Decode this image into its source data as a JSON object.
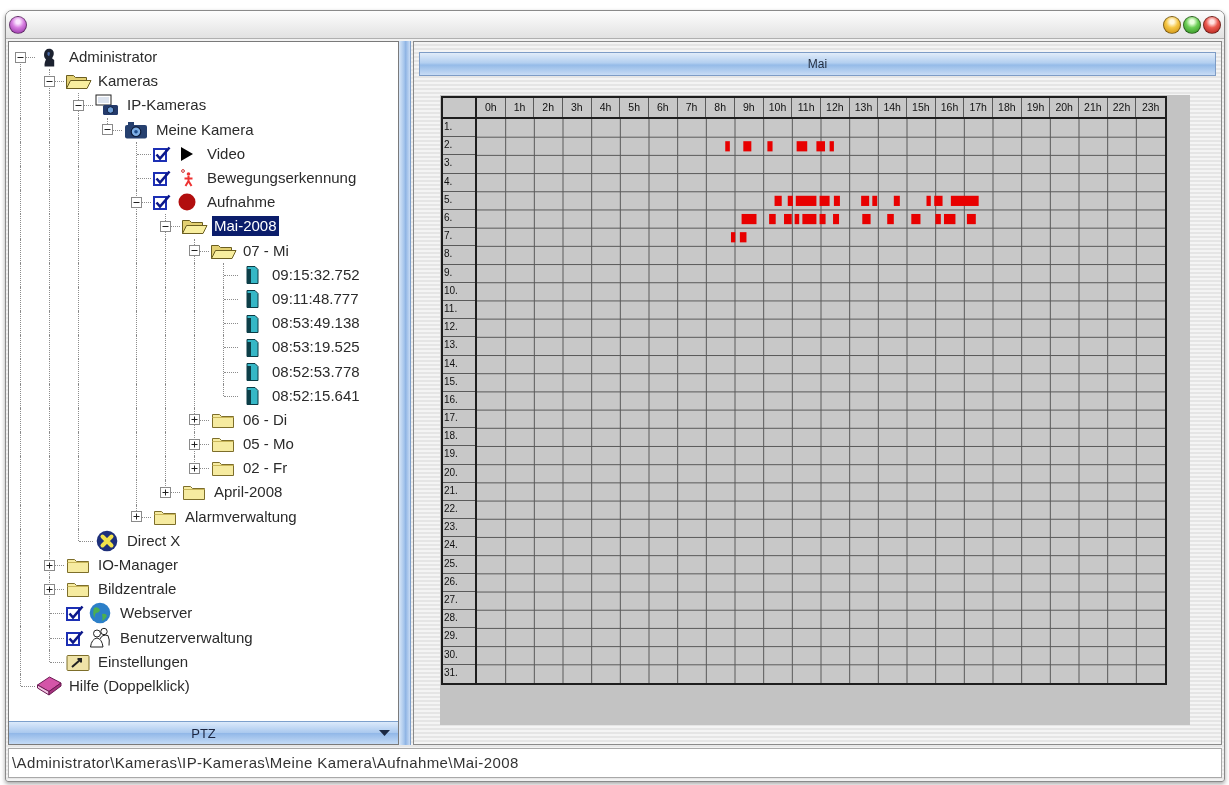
{
  "tree": [
    {
      "label": "Administrator",
      "kind": "user",
      "expanded": true,
      "selected": false,
      "children": [
        {
          "label": "Kameras",
          "kind": "folder",
          "expanded": true,
          "selected": false,
          "children": [
            {
              "label": "IP-Kameras",
              "kind": "network_camera",
              "expanded": true,
              "selected": false,
              "children": [
                {
                  "label": "Meine Kamera",
                  "kind": "camera",
                  "expanded": true,
                  "selected": false,
                  "children": [
                    {
                      "label": "Video",
                      "kind": "video",
                      "checked": true,
                      "selected": false
                    },
                    {
                      "label": "Bewegungserkennung",
                      "kind": "motion",
                      "checked": true,
                      "selected": false
                    },
                    {
                      "label": "Aufnahme",
                      "kind": "recording",
                      "checked": true,
                      "expanded": true,
                      "selected": false,
                      "children": [
                        {
                          "label": "Mai-2008",
                          "kind": "folder",
                          "expanded": true,
                          "selected": true,
                          "children": [
                            {
                              "label": "07 - Mi",
                              "kind": "folder",
                              "expanded": true,
                              "selected": false,
                              "children": [
                                {
                                  "label": "09:15:32.752",
                                  "kind": "clip",
                                  "selected": false
                                },
                                {
                                  "label": "09:11:48.777",
                                  "kind": "clip",
                                  "selected": false
                                },
                                {
                                  "label": "08:53:49.138",
                                  "kind": "clip",
                                  "selected": false
                                },
                                {
                                  "label": "08:53:19.525",
                                  "kind": "clip",
                                  "selected": false
                                },
                                {
                                  "label": "08:52:53.778",
                                  "kind": "clip",
                                  "selected": false
                                },
                                {
                                  "label": "08:52:15.641",
                                  "kind": "clip",
                                  "selected": false
                                }
                              ]
                            },
                            {
                              "label": "06 - Di",
                              "kind": "folder",
                              "expanded": false,
                              "selected": false
                            },
                            {
                              "label": "05 - Mo",
                              "kind": "folder",
                              "expanded": false,
                              "selected": false
                            },
                            {
                              "label": "02 - Fr",
                              "kind": "folder",
                              "expanded": false,
                              "selected": false
                            }
                          ]
                        },
                        {
                          "label": "April-2008",
                          "kind": "folder",
                          "expanded": false,
                          "selected": false
                        }
                      ]
                    },
                    {
                      "label": "Alarmverwaltung",
                      "kind": "folder",
                      "expanded": false,
                      "selected": false
                    }
                  ]
                }
              ]
            },
            {
              "label": "Direct X",
              "kind": "directx",
              "selected": false
            }
          ]
        },
        {
          "label": "IO-Manager",
          "kind": "folder",
          "expanded": false,
          "selected": false
        },
        {
          "label": "Bildzentrale",
          "kind": "folder",
          "expanded": false,
          "selected": false
        },
        {
          "label": "Webserver",
          "kind": "web",
          "checked": true,
          "selected": false
        },
        {
          "label": "Benutzerverwaltung",
          "kind": "users",
          "checked": true,
          "selected": false
        },
        {
          "label": "Einstellungen",
          "kind": "settings",
          "selected": false
        }
      ]
    },
    {
      "label": "Hilfe (Doppelklick)",
      "kind": "help",
      "selected": false
    }
  ],
  "ptz_panel": {
    "label": "PTZ"
  },
  "calendar": {
    "title": "Mai",
    "chart_data": [
      {
        "type": "bar",
        "orientation": "horizontal",
        "grid": true,
        "categories": [
          "1.",
          "2.",
          "3.",
          "4.",
          "5.",
          "6.",
          "7.",
          "8.",
          "9.",
          "10.",
          "11.",
          "12.",
          "13.",
          "14.",
          "15.",
          "16.",
          "17.",
          "18.",
          "19.",
          "20.",
          "21.",
          "22.",
          "23.",
          "24.",
          "25.",
          "26.",
          "27.",
          "28.",
          "29.",
          "30.",
          "31."
        ],
        "xlim": [
          0,
          24
        ],
        "xticks": [
          {
            "value": 0.5,
            "label": "0h"
          },
          {
            "value": 1.5,
            "label": "1h"
          },
          {
            "value": 2.5,
            "label": "2h"
          },
          {
            "value": 3.5,
            "label": "3h"
          },
          {
            "value": 4.5,
            "label": "4h"
          },
          {
            "value": 5.5,
            "label": "5h"
          },
          {
            "value": 6.5,
            "label": "6h"
          },
          {
            "value": 7.5,
            "label": "7h"
          },
          {
            "value": 8.5,
            "label": "8h"
          },
          {
            "value": 9.5,
            "label": "9h"
          },
          {
            "value": 10.5,
            "label": "10h"
          },
          {
            "value": 11.5,
            "label": "11h"
          },
          {
            "value": 12.5,
            "label": "12h"
          },
          {
            "value": 13.5,
            "label": "13h"
          },
          {
            "value": 14.5,
            "label": "14h"
          },
          {
            "value": 15.5,
            "label": "15h"
          },
          {
            "value": 16.5,
            "label": "16h"
          },
          {
            "value": 17.5,
            "label": "17h"
          },
          {
            "value": 18.5,
            "label": "18h"
          },
          {
            "value": 19.5,
            "label": "19h"
          },
          {
            "value": 20.5,
            "label": "20h"
          },
          {
            "value": 21.5,
            "label": "21h"
          },
          {
            "value": 22.5,
            "label": "22h"
          },
          {
            "value": 23.5,
            "label": "23h"
          }
        ],
        "series": [
          {
            "color": "#e80000",
            "base": [
              null,
              8.66,
              null,
              null,
              10.38,
              9.23,
              8.86,
              null,
              null,
              null,
              null,
              null,
              null,
              null,
              null,
              null,
              null,
              null,
              null,
              null,
              null,
              null,
              null,
              null,
              null,
              null,
              null,
              null,
              null,
              null,
              null
            ],
            "values": [
              null,
              0.16,
              null,
              null,
              0.25,
              0.52,
              0.15,
              null,
              null,
              null,
              null,
              null,
              null,
              null,
              null,
              null,
              null,
              null,
              null,
              null,
              null,
              null,
              null,
              null,
              null,
              null,
              null,
              null,
              null,
              null,
              null
            ]
          },
          {
            "color": "#e80000",
            "base": [
              null,
              9.29,
              null,
              null,
              10.84,
              10.19,
              9.17,
              null,
              null,
              null,
              null,
              null,
              null,
              null,
              null,
              null,
              null,
              null,
              null,
              null,
              null,
              null,
              null,
              null,
              null,
              null,
              null,
              null,
              null,
              null,
              null
            ],
            "values": [
              null,
              0.28,
              null,
              null,
              0.18,
              0.23,
              0.23,
              null,
              null,
              null,
              null,
              null,
              null,
              null,
              null,
              null,
              null,
              null,
              null,
              null,
              null,
              null,
              null,
              null,
              null,
              null,
              null,
              null,
              null,
              null,
              null
            ]
          },
          {
            "color": "#e80000",
            "base": [
              null,
              10.13,
              null,
              null,
              11.12,
              10.71,
              null,
              null,
              null,
              null,
              null,
              null,
              null,
              null,
              null,
              null,
              null,
              null,
              null,
              null,
              null,
              null,
              null,
              null,
              null,
              null,
              null,
              null,
              null,
              null,
              null
            ],
            "values": [
              null,
              0.18,
              null,
              null,
              0.72,
              0.27,
              null,
              null,
              null,
              null,
              null,
              null,
              null,
              null,
              null,
              null,
              null,
              null,
              null,
              null,
              null,
              null,
              null,
              null,
              null,
              null,
              null,
              null,
              null,
              null,
              null
            ]
          },
          {
            "color": "#e80000",
            "base": [
              null,
              11.15,
              null,
              null,
              11.95,
              11.08,
              null,
              null,
              null,
              null,
              null,
              null,
              null,
              null,
              null,
              null,
              null,
              null,
              null,
              null,
              null,
              null,
              null,
              null,
              null,
              null,
              null,
              null,
              null,
              null,
              null
            ],
            "values": [
              null,
              0.37,
              null,
              null,
              0.35,
              0.16,
              null,
              null,
              null,
              null,
              null,
              null,
              null,
              null,
              null,
              null,
              null,
              null,
              null,
              null,
              null,
              null,
              null,
              null,
              null,
              null,
              null,
              null,
              null,
              null,
              null
            ]
          },
          {
            "color": "#e80000",
            "base": [
              null,
              11.84,
              null,
              null,
              12.45,
              11.35,
              null,
              null,
              null,
              null,
              null,
              null,
              null,
              null,
              null,
              null,
              null,
              null,
              null,
              null,
              null,
              null,
              null,
              null,
              null,
              null,
              null,
              null,
              null,
              null,
              null
            ],
            "values": [
              null,
              0.3,
              null,
              null,
              0.21,
              0.49,
              null,
              null,
              null,
              null,
              null,
              null,
              null,
              null,
              null,
              null,
              null,
              null,
              null,
              null,
              null,
              null,
              null,
              null,
              null,
              null,
              null,
              null,
              null,
              null,
              null
            ]
          },
          {
            "color": "#e80000",
            "base": [
              null,
              12.3,
              null,
              null,
              13.4,
              11.95,
              null,
              null,
              null,
              null,
              null,
              null,
              null,
              null,
              null,
              null,
              null,
              null,
              null,
              null,
              null,
              null,
              null,
              null,
              null,
              null,
              null,
              null,
              null,
              null,
              null
            ],
            "values": [
              null,
              0.15,
              null,
              null,
              0.28,
              0.21,
              null,
              null,
              null,
              null,
              null,
              null,
              null,
              null,
              null,
              null,
              null,
              null,
              null,
              null,
              null,
              null,
              null,
              null,
              null,
              null,
              null,
              null,
              null,
              null,
              null
            ]
          },
          {
            "color": "#e80000",
            "base": [
              null,
              null,
              null,
              null,
              13.79,
              12.42,
              null,
              null,
              null,
              null,
              null,
              null,
              null,
              null,
              null,
              null,
              null,
              null,
              null,
              null,
              null,
              null,
              null,
              null,
              null,
              null,
              null,
              null,
              null,
              null,
              null
            ],
            "values": [
              null,
              null,
              null,
              null,
              0.17,
              0.21,
              null,
              null,
              null,
              null,
              null,
              null,
              null,
              null,
              null,
              null,
              null,
              null,
              null,
              null,
              null,
              null,
              null,
              null,
              null,
              null,
              null,
              null,
              null,
              null,
              null
            ]
          },
          {
            "color": "#e80000",
            "base": [
              null,
              null,
              null,
              null,
              14.54,
              13.44,
              null,
              null,
              null,
              null,
              null,
              null,
              null,
              null,
              null,
              null,
              null,
              null,
              null,
              null,
              null,
              null,
              null,
              null,
              null,
              null,
              null,
              null,
              null,
              null,
              null
            ],
            "values": [
              null,
              null,
              null,
              null,
              0.21,
              0.29,
              null,
              null,
              null,
              null,
              null,
              null,
              null,
              null,
              null,
              null,
              null,
              null,
              null,
              null,
              null,
              null,
              null,
              null,
              null,
              null,
              null,
              null,
              null,
              null,
              null
            ]
          },
          {
            "color": "#e80000",
            "base": [
              null,
              null,
              null,
              null,
              15.68,
              14.31,
              null,
              null,
              null,
              null,
              null,
              null,
              null,
              null,
              null,
              null,
              null,
              null,
              null,
              null,
              null,
              null,
              null,
              null,
              null,
              null,
              null,
              null,
              null,
              null,
              null
            ],
            "values": [
              null,
              null,
              null,
              null,
              0.15,
              0.23,
              null,
              null,
              null,
              null,
              null,
              null,
              null,
              null,
              null,
              null,
              null,
              null,
              null,
              null,
              null,
              null,
              null,
              null,
              null,
              null,
              null,
              null,
              null,
              null,
              null
            ]
          },
          {
            "color": "#e80000",
            "base": [
              null,
              null,
              null,
              null,
              15.95,
              15.15,
              null,
              null,
              null,
              null,
              null,
              null,
              null,
              null,
              null,
              null,
              null,
              null,
              null,
              null,
              null,
              null,
              null,
              null,
              null,
              null,
              null,
              null,
              null,
              null,
              null
            ],
            "values": [
              null,
              null,
              null,
              null,
              0.29,
              0.32,
              null,
              null,
              null,
              null,
              null,
              null,
              null,
              null,
              null,
              null,
              null,
              null,
              null,
              null,
              null,
              null,
              null,
              null,
              null,
              null,
              null,
              null,
              null,
              null,
              null
            ]
          },
          {
            "color": "#e80000",
            "base": [
              null,
              null,
              null,
              null,
              16.53,
              15.99,
              null,
              null,
              null,
              null,
              null,
              null,
              null,
              null,
              null,
              null,
              null,
              null,
              null,
              null,
              null,
              null,
              null,
              null,
              null,
              null,
              null,
              null,
              null,
              null,
              null
            ],
            "values": [
              null,
              null,
              null,
              null,
              0.97,
              0.19,
              null,
              null,
              null,
              null,
              null,
              null,
              null,
              null,
              null,
              null,
              null,
              null,
              null,
              null,
              null,
              null,
              null,
              null,
              null,
              null,
              null,
              null,
              null,
              null,
              null
            ]
          },
          {
            "color": "#e80000",
            "base": [
              null,
              null,
              null,
              null,
              null,
              16.29,
              null,
              null,
              null,
              null,
              null,
              null,
              null,
              null,
              null,
              null,
              null,
              null,
              null,
              null,
              null,
              null,
              null,
              null,
              null,
              null,
              null,
              null,
              null,
              null,
              null
            ],
            "values": [
              null,
              null,
              null,
              null,
              null,
              0.4,
              null,
              null,
              null,
              null,
              null,
              null,
              null,
              null,
              null,
              null,
              null,
              null,
              null,
              null,
              null,
              null,
              null,
              null,
              null,
              null,
              null,
              null,
              null,
              null,
              null
            ]
          },
          {
            "color": "#e80000",
            "base": [
              null,
              null,
              null,
              null,
              null,
              17.09,
              null,
              null,
              null,
              null,
              null,
              null,
              null,
              null,
              null,
              null,
              null,
              null,
              null,
              null,
              null,
              null,
              null,
              null,
              null,
              null,
              null,
              null,
              null,
              null,
              null
            ],
            "values": [
              null,
              null,
              null,
              null,
              null,
              0.31,
              null,
              null,
              null,
              null,
              null,
              null,
              null,
              null,
              null,
              null,
              null,
              null,
              null,
              null,
              null,
              null,
              null,
              null,
              null,
              null,
              null,
              null,
              null,
              null,
              null
            ]
          }
        ]
      }
    ]
  },
  "status_bar": {
    "path": "\\Administrator\\Kameras\\IP-Kameras\\Meine Kamera\\Aufnahme\\Mai-2008"
  }
}
